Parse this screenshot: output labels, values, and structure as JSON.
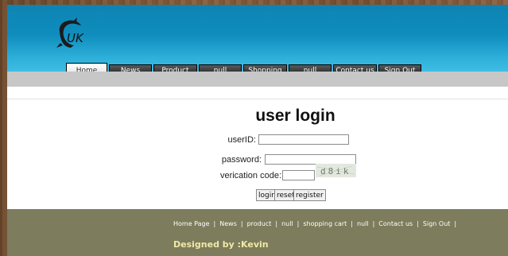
{
  "nav": {
    "tabs": [
      {
        "label": "Home Page",
        "width": 50
      },
      {
        "label": "News",
        "width": 52
      },
      {
        "label": "Product",
        "width": 53
      },
      {
        "label": "null",
        "width": 52
      },
      {
        "label": "Shopping cart",
        "width": 53
      },
      {
        "label": "null",
        "width": 52
      },
      {
        "label": "Contact us",
        "width": 53
      },
      {
        "label": "Sign Out",
        "width": 52
      }
    ]
  },
  "login": {
    "title": "user login",
    "userid_label": "userID:",
    "password_label": "password:",
    "verification_label": "verication code:",
    "captcha_text": "d8ik",
    "login_button": "login",
    "reset_button": "reset",
    "register_button": "register"
  },
  "footer": {
    "links": [
      "Home Page",
      "News",
      "product",
      "null",
      "shopping cart",
      "null",
      "Contact us",
      "Sign Out"
    ],
    "designed_by": "Designed by :Kevin"
  },
  "colors": {
    "header_blue": "#1a9ccb",
    "footer_olive": "#7d7c5c",
    "designed_text": "#f0e9a6"
  }
}
